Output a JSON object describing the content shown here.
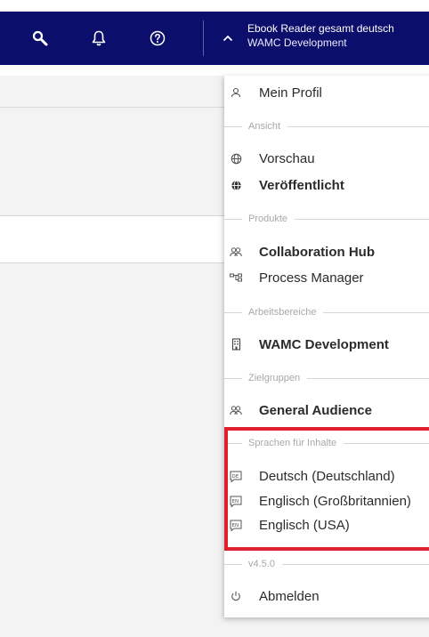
{
  "header": {
    "search_icon": "search-icon",
    "bell_icon": "bell-icon",
    "help_icon": "help-icon",
    "account_title": "Ebook Reader gesamt deutsch",
    "account_subtitle": "WAMC Development"
  },
  "menu": {
    "profile": "Mein Profil",
    "section_view": "Ansicht",
    "preview": "Vorschau",
    "published": "Veröffentlicht",
    "section_products": "Produkte",
    "collab": "Collaboration Hub",
    "process": "Process Manager",
    "section_workspaces": "Arbeitsbereiche",
    "workspace": "WAMC Development",
    "section_audiences": "Zielgruppen",
    "audience": "General Audience",
    "section_languages": "Sprachen für Inhalte",
    "lang_de": "Deutsch (Deutschland)",
    "lang_en_gb": "Englisch (Großbritannien)",
    "lang_en_us": "Englisch (USA)",
    "version": "v4.5.0",
    "logout": "Abmelden"
  },
  "colors": {
    "nav_bg": "#0b0f6b",
    "highlight": "#e0202e"
  }
}
